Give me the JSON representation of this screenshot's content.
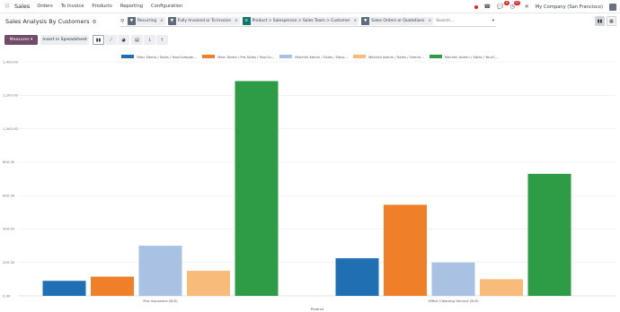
{
  "nav": {
    "brand": "Sales",
    "menu": [
      "Orders",
      "To Invoice",
      "Products",
      "Reporting",
      "Configuration"
    ],
    "chat_badge": "6",
    "activity_badge": "33",
    "company": "My Company (San Francisco)"
  },
  "control": {
    "title": "Sales Analysis By Customers",
    "facets": [
      {
        "tag": "filter",
        "text": "Recurring",
        "color": "#5f6b7a"
      },
      {
        "tag": "filter",
        "text": "Fully Invoiced  or  To Invoice",
        "color": "#5f6b7a"
      },
      {
        "tag": "group",
        "text": "Product > Salesperson > Sales Team > Customer",
        "color": "#0f766e"
      },
      {
        "tag": "filter",
        "text": "Sales Orders  or  Quotations",
        "color": "#5f6b7a"
      }
    ],
    "search_placeholder": "Search..."
  },
  "toolbar": {
    "measures_label": "Measures",
    "insert_label": "Insert in Spreadsheet"
  },
  "chart_data": {
    "type": "bar",
    "xlabel": "Product",
    "ylabel": "",
    "ylim": [
      0,
      1400
    ],
    "yticks": [
      "0.00",
      "200.00",
      "400.00",
      "600.00",
      "800.00",
      "1,000.00",
      "1,200.00",
      "1,400.00"
    ],
    "categories": [
      "Fire Insurance (B-R)",
      "Office Cleaning Service (B-R)"
    ],
    "series": [
      {
        "name": "Marc Demo / Sales / YourCompan...",
        "color": "#1f6fb2",
        "values": [
          90,
          225
        ]
      },
      {
        "name": "Marc Demo / Pre-Sales / YourCo...",
        "color": "#f07f2a",
        "values": [
          115,
          545
        ]
      },
      {
        "name": "Mitchell Admin / Sales / Deco...",
        "color": "#a9c2e3",
        "values": [
          300,
          200
        ]
      },
      {
        "name": "Mitchell Admin / Sales / Gemin...",
        "color": "#f9bb7a",
        "values": [
          150,
          100
        ]
      },
      {
        "name": "Mitchell Admin / Sales / YourC...",
        "color": "#2e9b46",
        "values": [
          1285,
          730
        ]
      }
    ]
  }
}
